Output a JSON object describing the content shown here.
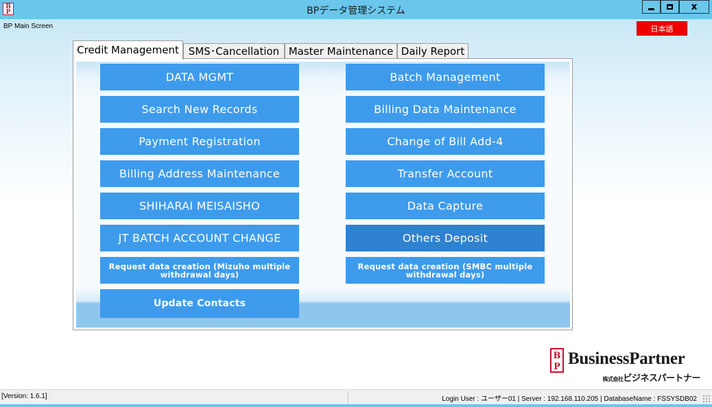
{
  "window": {
    "title": "BPデータ管理システム",
    "controls": {
      "minimize": "minimize",
      "maximize": "maximize",
      "close": "x"
    }
  },
  "form": {
    "title": "BP Main Screen",
    "language_button": "日本語"
  },
  "tabs": [
    {
      "label": "Credit Management",
      "active": true
    },
    {
      "label": "SMS･Cancellation",
      "active": false
    },
    {
      "label": "Master Maintenance",
      "active": false
    },
    {
      "label": "Daily Report",
      "active": false
    }
  ],
  "buttons": {
    "left": [
      "DATA MGMT",
      "Search New Records",
      "Payment Registration",
      "Billing Address Maintenance",
      "SHIHARAI MEISAISHO",
      "JT BATCH ACCOUNT CHANGE",
      "Request data creation (Mizuho multiple withdrawal days)",
      "Update Contacts"
    ],
    "right": [
      "Batch Management",
      "Billing Data Maintenance",
      "Change of Bill Add-4",
      "Transfer Account",
      "Data Capture",
      "Others Deposit",
      "Request data creation (SMBC multiple withdrawal days)"
    ]
  },
  "colors": {
    "button": "#3e9bec",
    "button_pressed": "#2f82cf",
    "titlebar": "#6ac6ea",
    "language_button": "#ee0000",
    "logo_red": "#c8102e"
  },
  "logo": {
    "name": "BusinessPartner",
    "sub_small": "株式会社",
    "sub_main": "ビジネスパートナー",
    "mark": "BP"
  },
  "statusbar": {
    "version": "[Version: 1.6.1]",
    "login_info": "Login User : ユーザー01 | Server : 192.168.110.205 | DatabaseName : FSSYSDB02"
  }
}
